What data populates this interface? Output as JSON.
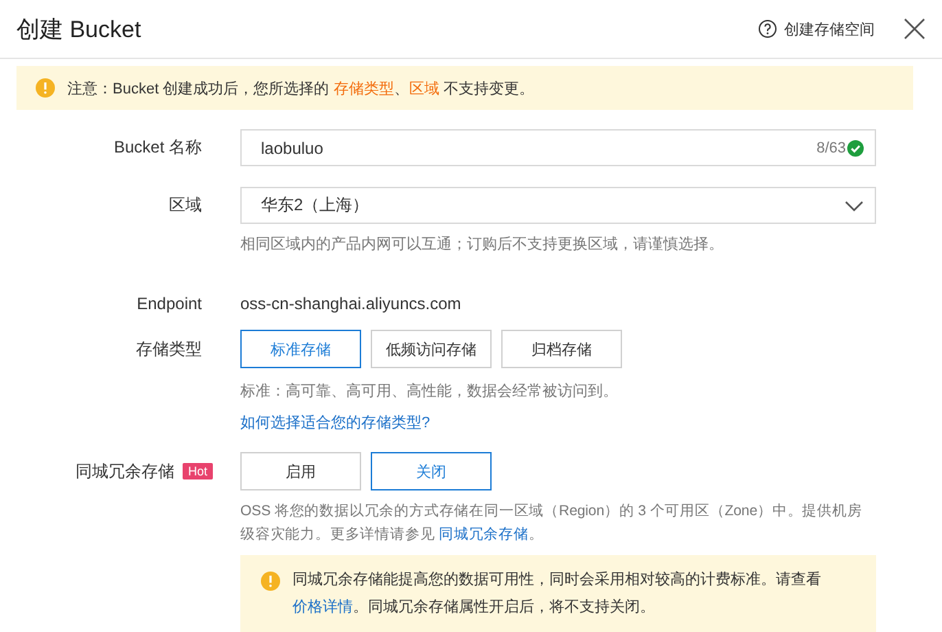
{
  "header": {
    "title": "创建 Bucket",
    "help_link": "创建存储空间"
  },
  "notice": {
    "parts": [
      {
        "text": "注意：Bucket 创建成功后，您所选择的 ",
        "highlight": false
      },
      {
        "text": "存储类型",
        "highlight": true
      },
      {
        "text": "、",
        "highlight": false
      },
      {
        "text": "区域",
        "highlight": true
      },
      {
        "text": " 不支持变更。",
        "highlight": false
      }
    ]
  },
  "name": {
    "label": "Bucket 名称",
    "value": "laobuluo",
    "counter": "8/63",
    "valid": true
  },
  "region": {
    "label": "区域",
    "value": "华东2（上海）",
    "help": "相同区域内的产品内网可以互通；订购后不支持更换区域，请谨慎选择。"
  },
  "endpoint": {
    "label": "Endpoint",
    "value": "oss-cn-shanghai.aliyuncs.com"
  },
  "storage_type": {
    "label": "存储类型",
    "options": [
      {
        "label": "标准存储",
        "selected": true
      },
      {
        "label": "低频访问存储",
        "selected": false
      },
      {
        "label": "归档存储",
        "selected": false
      }
    ],
    "description": "标准：高可靠、高可用、高性能，数据会经常被访问到。",
    "link": "如何选择适合您的存储类型?"
  },
  "redundancy": {
    "label": "同城冗余存储",
    "badge": "Hot",
    "options": [
      {
        "label": "启用",
        "selected": false
      },
      {
        "label": "关闭",
        "selected": true
      }
    ],
    "description": "OSS 将您的数据以冗余的方式存储在同一区域（Region）的 3 个可用区（Zone）中。提供机房级容灾能力。更多详情请参见 ",
    "link": "同城冗余存储",
    "description_end": "。",
    "warning": {
      "before": "同城冗余存储能提高您的数据可用性，同时会采用相对较高的计费标准。请查看",
      "link": "价格详情",
      "after": "。同城冗余存储属性开启后，将不支持关闭。"
    }
  }
}
